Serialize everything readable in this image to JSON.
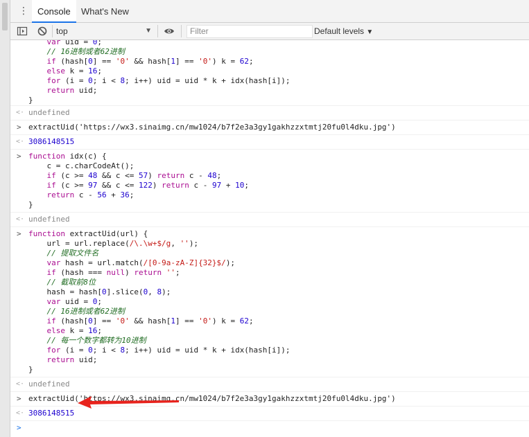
{
  "tabs": [
    {
      "label": "Console",
      "active": true
    },
    {
      "label": "What's New",
      "active": false
    }
  ],
  "toolbar": {
    "context": "top",
    "filter_placeholder": "Filter",
    "levels_label": "Default levels"
  },
  "console": {
    "block0": [
      "    var uid = 0;",
      "    // 16进制或者62进制",
      "    if (hash[0] == '0' && hash[1] == '0') k = 62;",
      "    else k = 16;",
      "    for (i = 0; i < 8; i++) uid = uid * k + idx(hash[i]);",
      "    return uid;",
      "}"
    ],
    "result_undefined_1": "undefined",
    "call_1": "extractUid('https://wx3.sinaimg.cn/mw1024/b7f2e3a3gy1gakhzzxtmtj20fu0l4dku.jpg')",
    "result_1": "3086148515",
    "block_idx": [
      "function idx(c) {",
      "    c = c.charCodeAt();",
      "    if (c >= 48 && c <= 57) return c - 48;",
      "    if (c >= 97 && c <= 122) return c - 97 + 10;",
      "    return c - 56 + 36;",
      "}"
    ],
    "result_undefined_2": "undefined",
    "block_extract": [
      "function extractUid(url) {",
      "    url = url.replace(/\\.\\w+$/g, '');",
      "    // 提取文件名",
      "    var hash = url.match(/[0-9a-zA-Z]{32}$/);",
      "    if (hash === null) return '';",
      "    // 截取前8位",
      "    hash = hash[0].slice(0, 8);",
      "    var uid = 0;",
      "    // 16进制或者62进制",
      "    if (hash[0] == '0' && hash[1] == '0') k = 62;",
      "    else k = 16;",
      "    // 每一个数字都转为10进制",
      "    for (i = 0; i < 8; i++) uid = uid * k + idx(hash[i]);",
      "    return uid;",
      "}"
    ],
    "result_undefined_3": "undefined",
    "call_2": "extractUid('https://wx3.sinaimg.cn/mw1024/b7f2e3a3gy1gakhzzxtmtj20fu0l4dku.jpg')",
    "result_2": "3086148515"
  },
  "colors": {
    "accent": "#1a73e8",
    "annotation_arrow": "#e8231d",
    "number": "#1c00cf",
    "keyword": "#aa0d91",
    "string": "#c41a16",
    "comment": "#236e25"
  }
}
